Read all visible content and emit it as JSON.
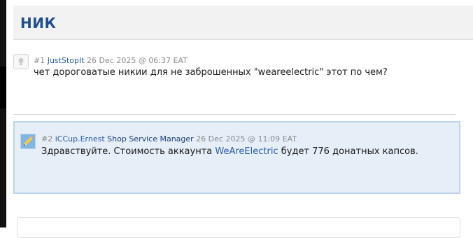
{
  "topic": {
    "title": "НИК"
  },
  "posts": [
    {
      "number": "#1",
      "author": "JustStopIt",
      "date": "26 Dec 2025 @ 06:37 EAT",
      "text": "чет дороговатые никии для не заброшенных \"weareelectric\" этот по чем?",
      "avatar_icon": "light-bulb-icon"
    },
    {
      "number": "#2",
      "author": "iCCup.Ernest",
      "role": "Shop Service Manager",
      "date": "26 Dec 2025 @ 11:09 EAT",
      "text_before": "Здравствуйте. Стоимость аккаунта ",
      "text_link": "WeAreElectric",
      "text_after": " будет 776 донатных капсов.",
      "avatar_icon": "pencil-icon"
    }
  ],
  "colors": {
    "title": "#1f4f8f",
    "link": "#2a5ba8",
    "highlight_bg": "#e6eef8",
    "highlight_border": "#bcd3ea"
  }
}
